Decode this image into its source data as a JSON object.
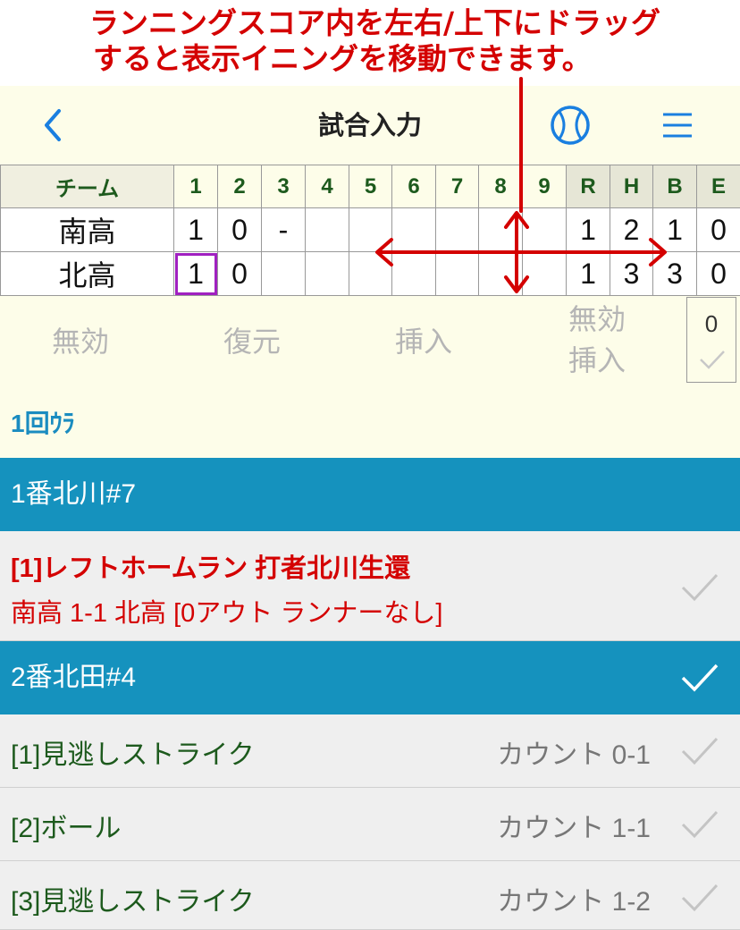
{
  "annotation": {
    "line1": "ランニングスコア内を左右/上下にドラッグ",
    "line2": "すると表示イニングを移動できます。"
  },
  "nav": {
    "title": "試合入力"
  },
  "scoreboard": {
    "team_header": "チーム",
    "innings": [
      "1",
      "2",
      "3",
      "4",
      "5",
      "6",
      "7",
      "8",
      "9"
    ],
    "totals_header": [
      "R",
      "H",
      "B",
      "E"
    ],
    "teams": [
      {
        "name": "南高",
        "innings": [
          "1",
          "0",
          "-",
          "",
          "",
          "",
          "",
          "",
          ""
        ],
        "totals": [
          "1",
          "2",
          "1",
          "0"
        ]
      },
      {
        "name": "北高",
        "innings": [
          "1",
          "0",
          "",
          "",
          "",
          "",
          "",
          "",
          ""
        ],
        "totals": [
          "1",
          "3",
          "3",
          "0"
        ]
      }
    ]
  },
  "actions": {
    "void": "無効",
    "restore": "復元",
    "insert": "挿入",
    "void_insert_1": "無効",
    "void_insert_2": "挿入"
  },
  "count_box": {
    "value": "0"
  },
  "inning_label": "1回ｳﾗ",
  "plays": {
    "batter1": "1番北川#7",
    "homerun_title": "[1]レフトホームラン 打者北川生還",
    "homerun_detail": "南高 1-1 北高 [0アウト ランナーなし]",
    "batter2": "2番北田#4",
    "pitches": [
      {
        "desc": "[1]見逃しストライク",
        "count": "カウント 0-1"
      },
      {
        "desc": "[2]ボール",
        "count": "カウント 1-1"
      },
      {
        "desc": "[3]見逃しストライク",
        "count": "カウント 1-2"
      }
    ]
  },
  "colors": {
    "annotation_red": "#d40000",
    "app_bg": "#fdfde9",
    "batter_header_bg": "#1592be",
    "team_south": "#d0476a",
    "team_north": "#1a8cc0",
    "selected_outline": "#a020c0",
    "pitch_text": "#1d5a1d"
  }
}
